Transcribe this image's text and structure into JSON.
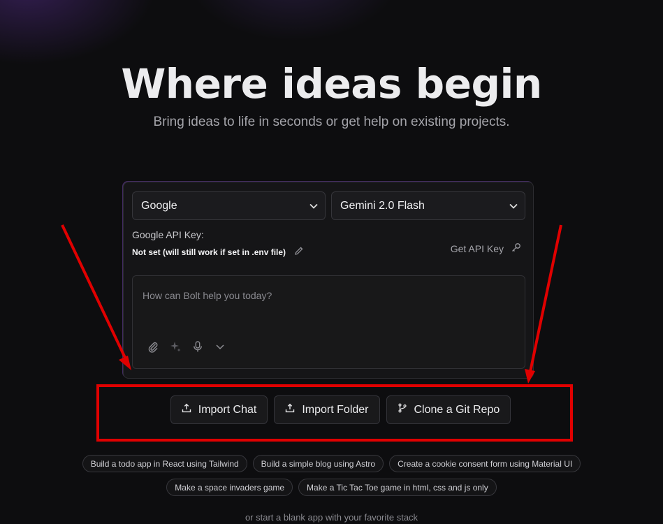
{
  "hero": {
    "title": "Where ideas begin",
    "subtitle": "Bring ideas to life in seconds or get help on existing projects."
  },
  "config": {
    "provider_selected": "Google",
    "model_selected": "Gemini 2.0 Flash",
    "api_key_label": "Google API Key:",
    "api_key_status": "Not set (will still work if set in .env file)",
    "get_api_key_label": "Get API Key"
  },
  "prompt": {
    "placeholder": "How can Bolt help you today?"
  },
  "import_actions": {
    "import_chat": "Import Chat",
    "import_folder": "Import Folder",
    "clone_repo": "Clone a Git Repo"
  },
  "suggestions": {
    "row1": [
      "Build a todo app in React using Tailwind",
      "Build a simple blog using Astro",
      "Create a cookie consent form using Material UI"
    ],
    "row2": [
      "Make a space invaders game",
      "Make a Tic Tac Toe game in html, css and js only"
    ]
  },
  "footer_text": "or start a blank app with your favorite stack",
  "colors": {
    "background": "#0d0d0f",
    "annotation_red": "#e00000",
    "accent_purple": "#9a5cff"
  }
}
